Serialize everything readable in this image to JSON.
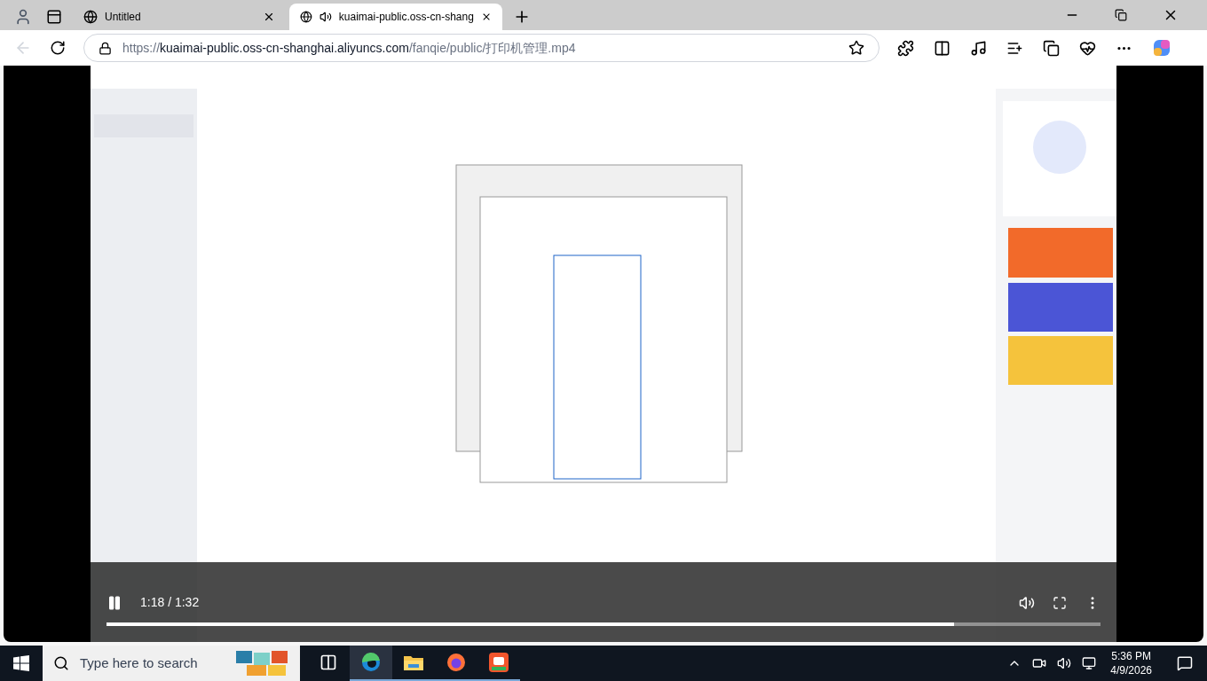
{
  "tabs": [
    {
      "title": "Untitled",
      "selected": false,
      "audio": false
    },
    {
      "title": "kuaimai-public.oss-cn-shang",
      "selected": true,
      "audio": true
    }
  ],
  "url": {
    "scheme": "https://",
    "host": "kuaimai-public.oss-cn-shanghai.aliyuncs.com",
    "path": "/fanqie/public/打印机管理.mp4"
  },
  "player": {
    "playing": true,
    "time": "1:18 / 1:32",
    "progress": {
      "level": 0.853
    }
  },
  "taskbar": {
    "search_placeholder": "Type here to search",
    "time": "5:36 PM",
    "date": "4/9/2026",
    "apps": [
      {
        "kind": "taskview",
        "active": false
      },
      {
        "kind": "edge",
        "active": true
      },
      {
        "kind": "explorer",
        "active": true
      },
      {
        "kind": "firefox",
        "active": true
      },
      {
        "kind": "store",
        "active": true
      }
    ]
  }
}
